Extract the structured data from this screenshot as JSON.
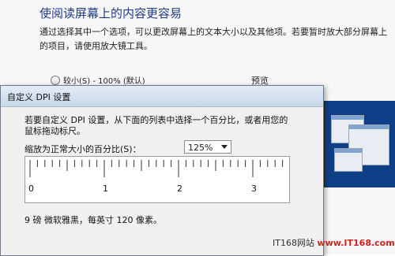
{
  "background": {
    "title": "使阅读屏幕上的内容更容易",
    "description": "通过选择其中一个选项，可以更改屏幕上的文本大小以及其他项。若要暂时放大部分屏幕上的项目，请使用放大镜工具。",
    "radio_option": "较小(S) - 100% (默认)",
    "preview_label": "预览"
  },
  "dialog": {
    "title": "自定义 DPI 设置",
    "instruction": "若要自定义 DPI 设置，从下面的列表中选择一个百分比，或者用您的鼠标拖动标尺。",
    "scale_label": "缩放为正常大小的百分比(S)：",
    "scale_value": "125%",
    "ruler_labels": [
      "0",
      "1",
      "2",
      "3"
    ],
    "font_info": "9 磅 微软雅黑，每英寸 120 像素。"
  },
  "watermark": {
    "left": "IT168网站",
    "right": "www.IT168.com"
  },
  "icons": {
    "dropdown": "chevron-down-icon",
    "radio": "radio-icon"
  }
}
